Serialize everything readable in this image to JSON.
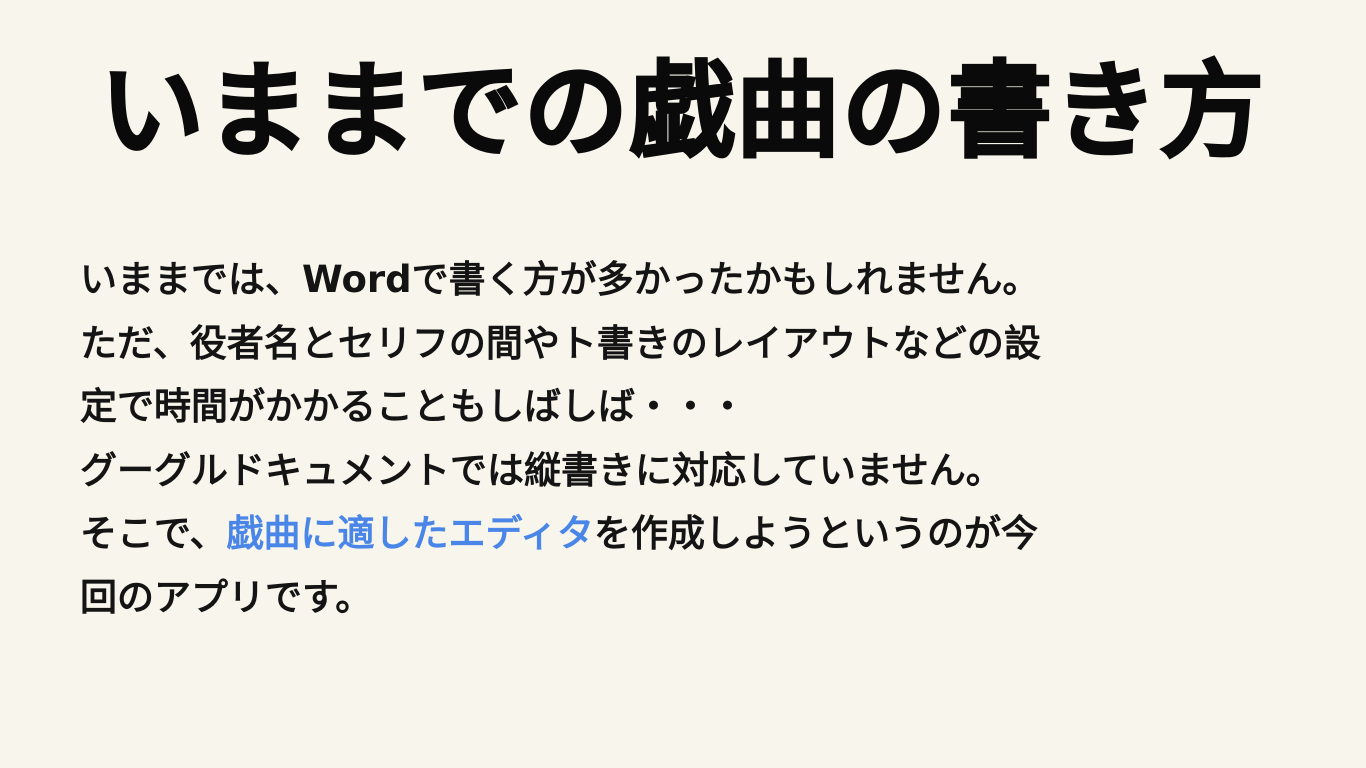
{
  "slide": {
    "title": "いままでの戯曲の書き方",
    "lines": [
      "いままでは、Wordで書く方が多かったかもしれません。",
      "ただ、役者名とセリフの間やト書きのレイアウトなどの設",
      "定で時間がかかることもしばしば・・・",
      "グーグルドキュメントでは縦書きに対応していません。"
    ],
    "line5_before": "そこで、",
    "line5_highlight": "戯曲に適したエディタ",
    "line5_after": "を作成しようというのが今",
    "line6": "回のアプリです。",
    "highlight_color": "#4a86e8"
  }
}
